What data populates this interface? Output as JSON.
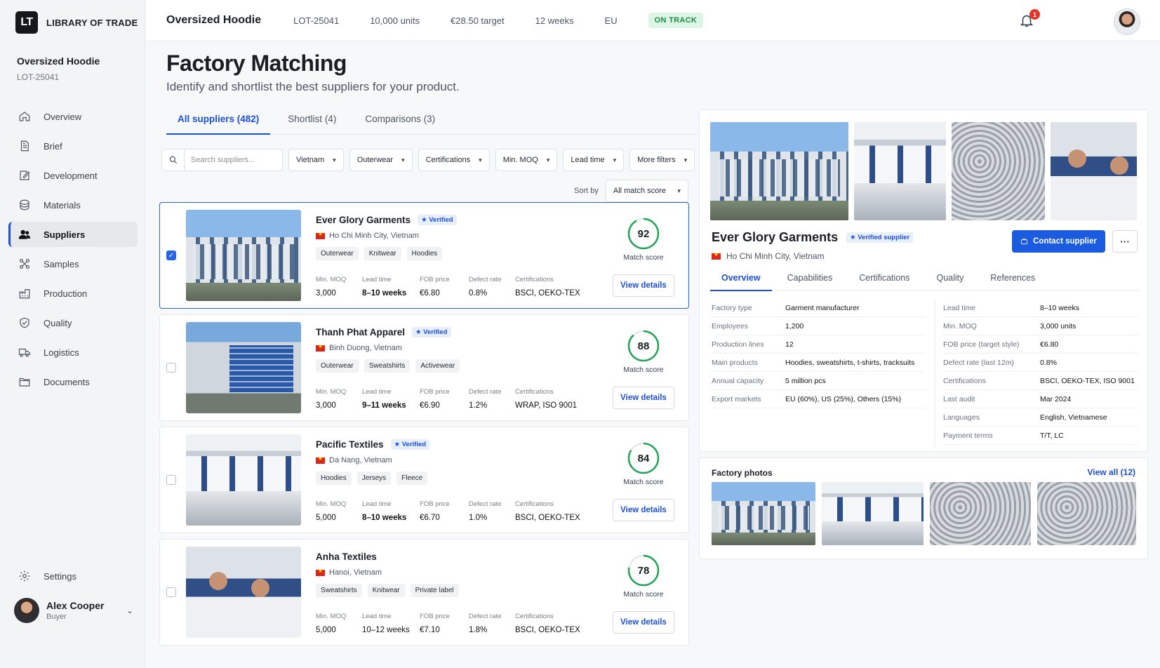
{
  "brand": {
    "logo": "LT",
    "name": "LIBRARY OF TRADE"
  },
  "product": {
    "title": "Oversized Hoodie",
    "lot": "LOT-25041"
  },
  "nav": [
    {
      "label": "Overview",
      "icon": "home-icon"
    },
    {
      "label": "Brief",
      "icon": "document-icon"
    },
    {
      "label": "Development",
      "icon": "edit-icon"
    },
    {
      "label": "Materials",
      "icon": "layers-icon"
    },
    {
      "label": "Suppliers",
      "icon": "users-icon",
      "active": true
    },
    {
      "label": "Samples",
      "icon": "samples-icon"
    },
    {
      "label": "Production",
      "icon": "factory-icon"
    },
    {
      "label": "Quality",
      "icon": "shield-icon"
    },
    {
      "label": "Logistics",
      "icon": "truck-icon"
    },
    {
      "label": "Documents",
      "icon": "folder-icon"
    }
  ],
  "settings_label": "Settings",
  "user": {
    "name": "Alex Cooper",
    "role": "Buyer"
  },
  "topbar": {
    "title": "Oversized Hoodie",
    "lot": "LOT-25041",
    "units": "10,000 units",
    "target": "€28.50 target",
    "weeks": "12 weeks",
    "region": "EU",
    "status": "ON TRACK",
    "notifications": "1"
  },
  "page": {
    "title": "Factory Matching",
    "subtitle": "Identify and shortlist the best suppliers for your product."
  },
  "tabs": [
    "All suppliers (482)",
    "Shortlist (4)",
    "Comparisons (3)"
  ],
  "filters": {
    "search_placeholder": "Search suppliers...",
    "buttons": [
      "Vietnam",
      "Outerwear",
      "Certifications",
      "Min. MOQ",
      "Lead time",
      "More filters"
    ],
    "sort_label": "Sort by",
    "sort_value": "All match score"
  },
  "stat_labels": {
    "moq": "Min. MOQ",
    "lead": "Lead time",
    "fob": "FOB price",
    "defect": "Defect rate",
    "cert": "Certifications"
  },
  "score_label": "Match score",
  "view_details": "View details",
  "verified_label": "★ Verified",
  "suppliers": [
    {
      "name": "Ever Glory Garments",
      "location": "Ho Chi Minh City, Vietnam",
      "tags": [
        "Outerwear",
        "Knitwear",
        "Hoodies"
      ],
      "moq": "3,000",
      "lead": "8–10 weeks",
      "fob": "€6.80",
      "defect": "0.8%",
      "cert": "BSCI, OEKO-TEX",
      "score": 92,
      "selected": true
    },
    {
      "name": "Thanh Phat Apparel",
      "location": "Binh Duong, Vietnam",
      "tags": [
        "Outerwear",
        "Sweatshirts",
        "Activewear"
      ],
      "moq": "3,000",
      "lead": "9–11 weeks",
      "fob": "€6.90",
      "defect": "1.2%",
      "cert": "WRAP, ISO 9001",
      "score": 88,
      "selected": false
    },
    {
      "name": "Pacific Textiles",
      "location": "Da Nang, Vietnam",
      "tags": [
        "Hoodies",
        "Jerseys",
        "Fleece"
      ],
      "moq": "5,000",
      "lead": "8–10 weeks",
      "fob": "€6.70",
      "defect": "1.0%",
      "cert": "BSCI, OEKO-TEX",
      "score": 84,
      "selected": false
    },
    {
      "name": "Anha Textiles",
      "location": "Hanoi, Vietnam",
      "tags": [
        "Sweatshirts",
        "Knitwear",
        "Private label"
      ],
      "moq": "5,000",
      "lead": "10–12 weeks",
      "fob": "€7.10",
      "defect": "1.8%",
      "cert": "BSCI, OEKO-TEX",
      "score": 78,
      "selected": false
    }
  ],
  "detail": {
    "name": "Ever Glory Garments",
    "verified": "★ Verified supplier",
    "location": "Ho Chi Minh City, Vietnam",
    "contact": "Contact supplier",
    "more": "···",
    "tabs": [
      "Overview",
      "Capabilities",
      "Certifications",
      "Quality",
      "References"
    ],
    "left": [
      {
        "k": "Factory type",
        "v": "Garment manufacturer"
      },
      {
        "k": "Employees",
        "v": "1,200"
      },
      {
        "k": "Production lines",
        "v": "12"
      },
      {
        "k": "Main products",
        "v": "Hoodies, sweatshirts, t-shirts, tracksuits"
      },
      {
        "k": "Annual capacity",
        "v": "5 million pcs"
      },
      {
        "k": "Export markets",
        "v": "EU (60%), US (25%), Others (15%)"
      }
    ],
    "right": [
      {
        "k": "Lead time",
        "v": "8–10 weeks"
      },
      {
        "k": "Min. MOQ",
        "v": "3,000 units"
      },
      {
        "k": "FOB price (target style)",
        "v": "€6.80"
      },
      {
        "k": "Defect rate (last 12m)",
        "v": "0.8%"
      },
      {
        "k": "Certifications",
        "v": "BSCI, OEKO-TEX, ISO 9001"
      },
      {
        "k": "Last audit",
        "v": "Mar 2024"
      },
      {
        "k": "Languages",
        "v": "English, Vietnamese"
      },
      {
        "k": "Payment terms",
        "v": "T/T, LC"
      }
    ]
  },
  "photos": {
    "title": "Factory photos",
    "view_all": "View all (12)"
  },
  "colors": {
    "accent": "#1d4ed8",
    "score_ring": "#22a35a",
    "status_bg": "#dcf5e4",
    "status_text": "#1f8a4a",
    "button_primary": "#1a5be0"
  }
}
